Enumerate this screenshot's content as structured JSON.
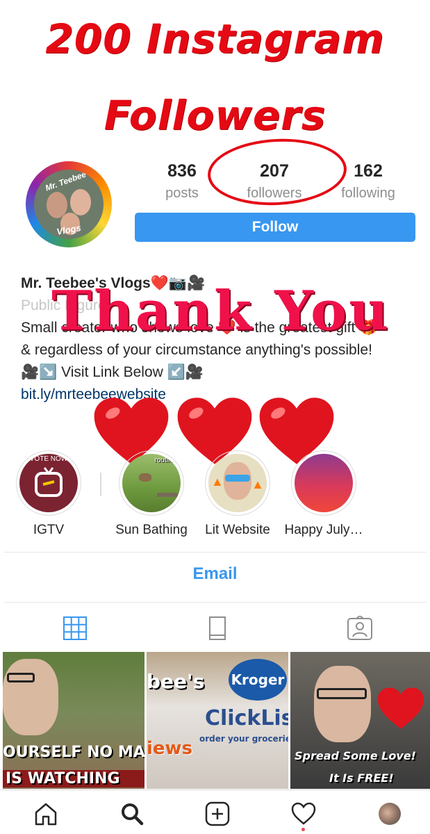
{
  "overlay": {
    "title_line1": "200 Instagram",
    "title_line2": "Followers",
    "thank_you": "Thank You"
  },
  "profile": {
    "stats": [
      {
        "value": "836",
        "label": "posts"
      },
      {
        "value": "207",
        "label": "followers"
      },
      {
        "value": "162",
        "label": "following"
      }
    ],
    "follow_label": "Follow",
    "avatar_text_top": "Mr. Teebee's",
    "avatar_text_bottom": "Vlogs",
    "name": "Mr. Teebee's Vlogs❤️📷🎥",
    "category": "Public Figure",
    "bio_line1": "Small creator who shows love ❤️ is the greatest gift 🎁",
    "bio_line2": "& regardless of your circumstance anything's possible!",
    "bio_line3": "🎥↘️ Visit Link Below ↙️🎥",
    "link": "bit.ly/mrteebeewebsite"
  },
  "highlights": [
    {
      "label": "IGTV",
      "overlay_text": "VOTE NOW"
    },
    {
      "label": "Sun Bathing",
      "overlay_text": "routine!"
    },
    {
      "label": "Lit Website",
      "overlay_text": ""
    },
    {
      "label": "Happy July…",
      "overlay_text": ""
    }
  ],
  "email_label": "Email",
  "tabs": [
    "grid-icon",
    "igtv-icon",
    "tagged-icon"
  ],
  "posts": [
    {
      "caption_line1": "OURSELF NO MA",
      "caption_line2": "IS WATCHING"
    },
    {
      "caption_line1": "Kroger",
      "caption_line2": "ClickLis",
      "caption_line3": "bee's",
      "caption_line4": "iews",
      "caption_line5": "order your groceries o"
    },
    {
      "caption_line1": "Spread Some Love!",
      "caption_line2": "It Is FREE!"
    }
  ],
  "colors": {
    "accent": "#3897f0",
    "overlay_red": "#e50914",
    "text": "#262626",
    "muted": "#8e8e8e"
  },
  "nav": [
    "home-icon",
    "search-icon",
    "new-post-icon",
    "activity-heart-icon",
    "profile-avatar"
  ]
}
